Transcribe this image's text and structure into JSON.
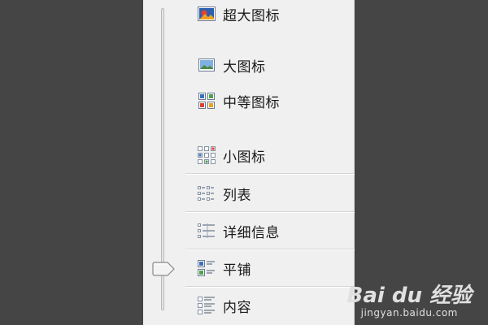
{
  "view_menu": {
    "items": [
      {
        "id": "extra-large-icons",
        "label": "超大图标",
        "icon": "extra-large-icons-icon"
      },
      {
        "id": "large-icons",
        "label": "大图标",
        "icon": "large-icons-icon"
      },
      {
        "id": "medium-icons",
        "label": "中等图标",
        "icon": "medium-icons-icon"
      },
      {
        "id": "small-icons",
        "label": "小图标",
        "icon": "small-icons-icon"
      },
      {
        "id": "list",
        "label": "列表",
        "icon": "list-view-icon"
      },
      {
        "id": "details",
        "label": "详细信息",
        "icon": "details-view-icon"
      },
      {
        "id": "tiles",
        "label": "平铺",
        "icon": "tiles-view-icon"
      },
      {
        "id": "content",
        "label": "内容",
        "icon": "content-view-icon"
      }
    ],
    "selected": "平铺"
  },
  "watermark": {
    "logo": "Bai du 经验",
    "url": "jingyan.baidu.com"
  },
  "colors": {
    "background": "#454545",
    "menu_bg": "#f0f0f0",
    "separator": "#d6d6d6"
  }
}
